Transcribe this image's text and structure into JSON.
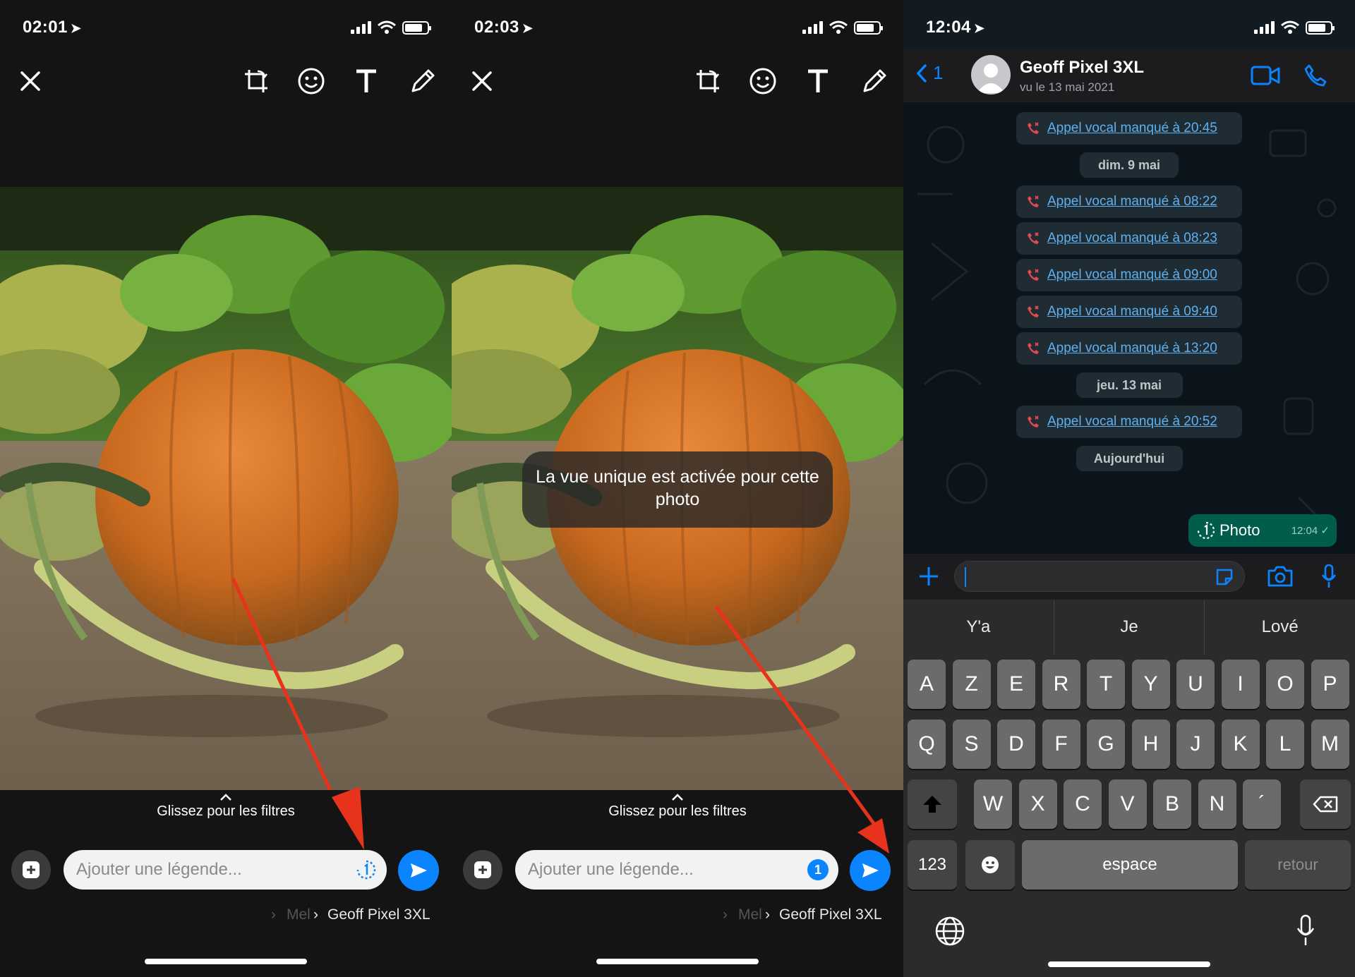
{
  "panels": [
    {
      "status_time": "02:01",
      "caption_placeholder": "Ajouter une légende...",
      "filters_hint": "Glissez pour les filtres",
      "recipient_prefix": "Mel",
      "recipient_name": "Geoff Pixel 3XL",
      "view_once_state": "off"
    },
    {
      "status_time": "02:03",
      "caption_placeholder": "Ajouter une légende...",
      "filters_hint": "Glissez pour les filtres",
      "recipient_prefix": "Mel",
      "recipient_name": "Geoff Pixel 3XL",
      "view_once_state": "on",
      "view_once_badge": "1",
      "toast": "La vue unique est activée pour cette photo"
    }
  ],
  "chat": {
    "status_time": "12:04",
    "back_count": "1",
    "contact_name": "Geoff Pixel 3XL",
    "contact_status": "vu le 13 mai 2021",
    "messages": [
      {
        "kind": "call",
        "text": "Appel vocal manqué à 20:45"
      },
      {
        "kind": "date",
        "text": "dim. 9 mai"
      },
      {
        "kind": "call",
        "text": "Appel vocal manqué à 08:22"
      },
      {
        "kind": "call",
        "text": "Appel vocal manqué à 08:23"
      },
      {
        "kind": "call",
        "text": "Appel vocal manqué à 09:00"
      },
      {
        "kind": "call",
        "text": "Appel vocal manqué à 09:40"
      },
      {
        "kind": "call",
        "text": "Appel vocal manqué à 13:20"
      },
      {
        "kind": "date",
        "text": "jeu. 13 mai"
      },
      {
        "kind": "call",
        "text": "Appel vocal manqué à 20:52"
      },
      {
        "kind": "date",
        "text": "Aujourd'hui"
      }
    ],
    "outgoing": {
      "label": "Photo",
      "time": "12:04",
      "ticks": "✓"
    },
    "input_value": ""
  },
  "keyboard": {
    "suggestions": [
      "Y'a",
      "Je",
      "Lové"
    ],
    "row1": [
      "A",
      "Z",
      "E",
      "R",
      "T",
      "Y",
      "U",
      "I",
      "O",
      "P"
    ],
    "row2": [
      "Q",
      "S",
      "D",
      "F",
      "G",
      "H",
      "J",
      "K",
      "L",
      "M"
    ],
    "row3": [
      "W",
      "X",
      "C",
      "V",
      "B",
      "N",
      "´"
    ],
    "numbers_key": "123",
    "space_key": "espace",
    "return_key": "retour"
  },
  "colors": {
    "accent_blue": "#0a84ff",
    "missed_call_red": "#e5484d",
    "outgoing_bubble": "#005c4b",
    "annotation_arrow": "#e8331c"
  }
}
